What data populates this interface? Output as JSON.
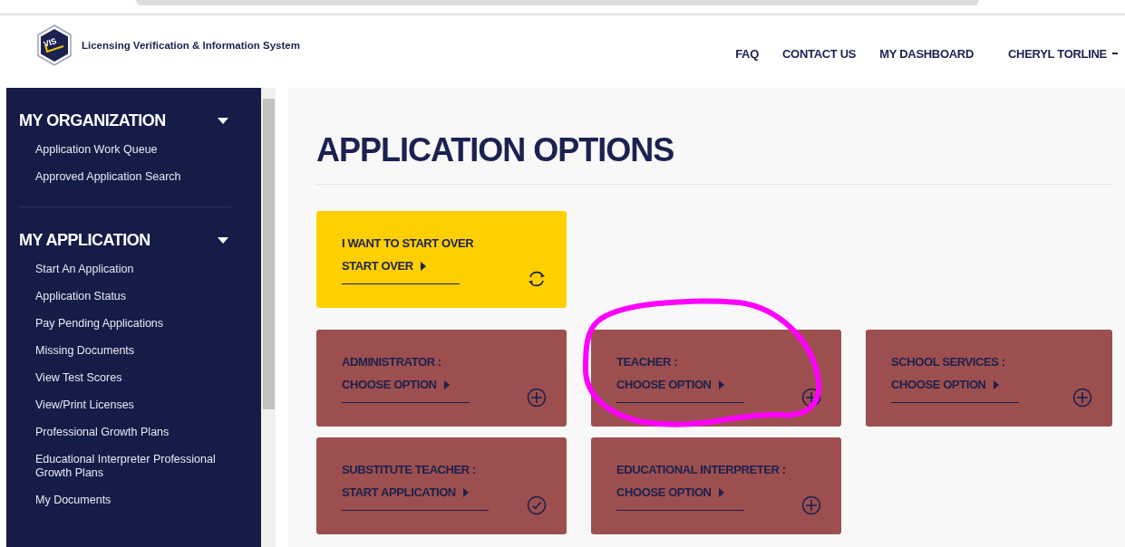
{
  "header": {
    "site_name": "Licensing Verification & Information System",
    "logo_text": "VIS",
    "nav": [
      "FAQ",
      "CONTACT US",
      "MY DASHBOARD"
    ],
    "user": "CHERYL TORLINE"
  },
  "sidebar": {
    "sections": [
      {
        "title": "MY ORGANIZATION",
        "expanded": true,
        "items": [
          "Application Work Queue",
          "Approved Application Search"
        ]
      },
      {
        "title": "MY APPLICATION",
        "expanded": true,
        "items": [
          "Start An Application",
          "Application Status",
          "Pay Pending Applications",
          "Missing Documents",
          "View Test Scores",
          "View/Print Licenses",
          "Professional Growth Plans",
          "Educational Interpreter Professional Growth Plans",
          "My Documents"
        ]
      }
    ]
  },
  "page_title": "APPLICATION OPTIONS",
  "start_over": {
    "title": "I WANT TO START OVER",
    "link": "START OVER",
    "kind": "refresh"
  },
  "cards": [
    {
      "title": "ADMINISTRATOR :",
      "link": "CHOOSE OPTION",
      "kind": "plus"
    },
    {
      "title": "TEACHER :",
      "link": "CHOOSE OPTION",
      "kind": "plus"
    },
    {
      "title": "SCHOOL SERVICES :",
      "link": "CHOOSE OPTION",
      "kind": "plus"
    },
    {
      "title": "SUBSTITUTE TEACHER :",
      "link": "START APPLICATION",
      "kind": "check"
    },
    {
      "title": "EDUCATIONAL INTERPRETER :",
      "link": "CHOOSE OPTION",
      "kind": "plus"
    }
  ],
  "annotation": {
    "kind": "circle",
    "color": "#ff00ff"
  }
}
